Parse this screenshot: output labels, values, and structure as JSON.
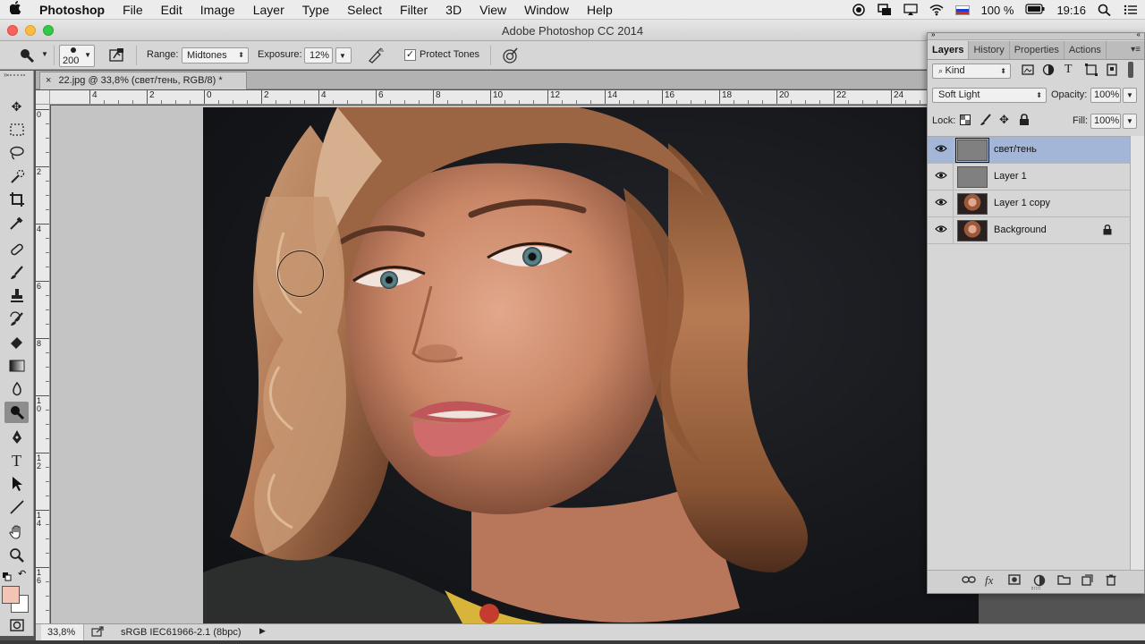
{
  "menubar": {
    "app_name": "Photoshop",
    "items": [
      "File",
      "Edit",
      "Image",
      "Layer",
      "Type",
      "Select",
      "Filter",
      "3D",
      "View",
      "Window",
      "Help"
    ],
    "battery": "100 %",
    "clock": "19:16"
  },
  "window": {
    "title": "Adobe Photoshop CC 2014"
  },
  "options": {
    "brush_size": "200",
    "range_label": "Range:",
    "range_value": "Midtones",
    "exposure_label": "Exposure:",
    "exposure_value": "12%",
    "protect_tones_label": "Protect Tones",
    "protect_tones_checked": true
  },
  "document": {
    "tab_title": "22.jpg @ 33,8% (свет/тень, RGB/8) *",
    "close_glyph": "×"
  },
  "rulers": {
    "h_labels": [
      "4",
      "2",
      "0",
      "2",
      "4",
      "6",
      "8",
      "10",
      "12",
      "14",
      "16",
      "18",
      "20",
      "22",
      "24"
    ],
    "v_labels": [
      "0",
      "2",
      "4",
      "6",
      "8",
      "10",
      "12",
      "14",
      "16"
    ]
  },
  "status": {
    "zoom": "33,8%",
    "doc_info": "sRGB IEC61966-2.1 (8bpc)"
  },
  "panel": {
    "tabs": [
      "Layers",
      "History",
      "Properties",
      "Actions"
    ],
    "active_tab": "Layers",
    "filter_kind": "Kind",
    "blend_mode": "Soft Light",
    "opacity_label": "Opacity:",
    "opacity_value": "100%",
    "lock_label": "Lock:",
    "fill_label": "Fill:",
    "fill_value": "100%",
    "layers": [
      {
        "name": "свет/тень",
        "thumb": "gray",
        "selected": true,
        "locked": false
      },
      {
        "name": "Layer 1",
        "thumb": "gray",
        "selected": false,
        "locked": false
      },
      {
        "name": "Layer 1 copy",
        "thumb": "photo",
        "selected": false,
        "locked": false
      },
      {
        "name": "Background",
        "thumb": "photo",
        "selected": false,
        "locked": true
      }
    ]
  },
  "colors": {
    "foreground": "#f3c4b4",
    "background": "#ffffff",
    "selected_layer": "#a4b6d8"
  },
  "icons": {
    "menubar_right": [
      "record-icon",
      "display-icon",
      "airplay-icon",
      "wifi-icon",
      "flag-ru-icon",
      "battery-icon",
      "search-icon",
      "list-icon"
    ],
    "tools": [
      "move-tool-icon",
      "marquee-tool-icon",
      "lasso-tool-icon",
      "quick-select-tool-icon",
      "crop-tool-icon",
      "eyedropper-tool-icon",
      "healing-brush-tool-icon",
      "brush-tool-icon",
      "clone-stamp-tool-icon",
      "history-brush-tool-icon",
      "eraser-tool-icon",
      "gradient-tool-icon",
      "blur-tool-icon",
      "burn-tool-icon",
      "pen-tool-icon",
      "type-tool-icon",
      "path-selection-tool-icon",
      "line-tool-icon",
      "hand-tool-icon",
      "zoom-tool-icon",
      "color-swatches-icon",
      "quick-mask-icon"
    ]
  }
}
